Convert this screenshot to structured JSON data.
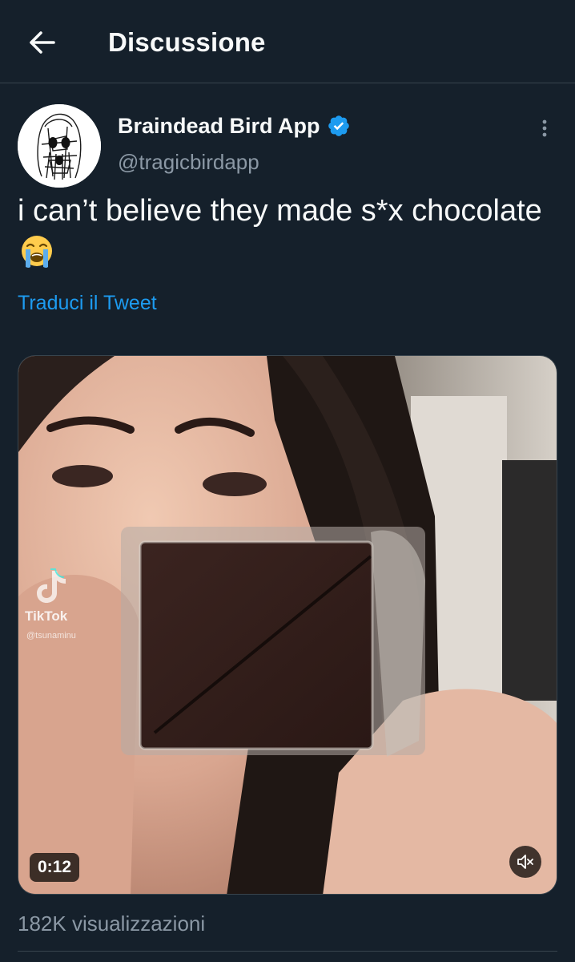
{
  "header": {
    "title": "Discussione",
    "back_icon": "arrow-left-icon"
  },
  "tweet": {
    "author": {
      "name": "Braindead Bird App",
      "handle": "@tragicbirdapp",
      "verified": true,
      "avatar_icon": "scribbled-face-avatar"
    },
    "text": "i can’t believe they made s*x chocolate",
    "emoji": "loudly-crying-face",
    "translate_label": "Traduci il Tweet",
    "more_icon": "more-vertical-icon",
    "media": {
      "type": "video",
      "duration": "0:12",
      "watermark_label": "TikTok",
      "watermark_user": "@tsunaminu",
      "mute_icon": "speaker-muted-icon"
    },
    "views": {
      "count": "182K",
      "label": "visualizzazioni"
    }
  },
  "colors": {
    "background": "#15202b",
    "accent": "#1d9bf0",
    "secondary_text": "#8b98a5",
    "divider": "#38444d"
  }
}
